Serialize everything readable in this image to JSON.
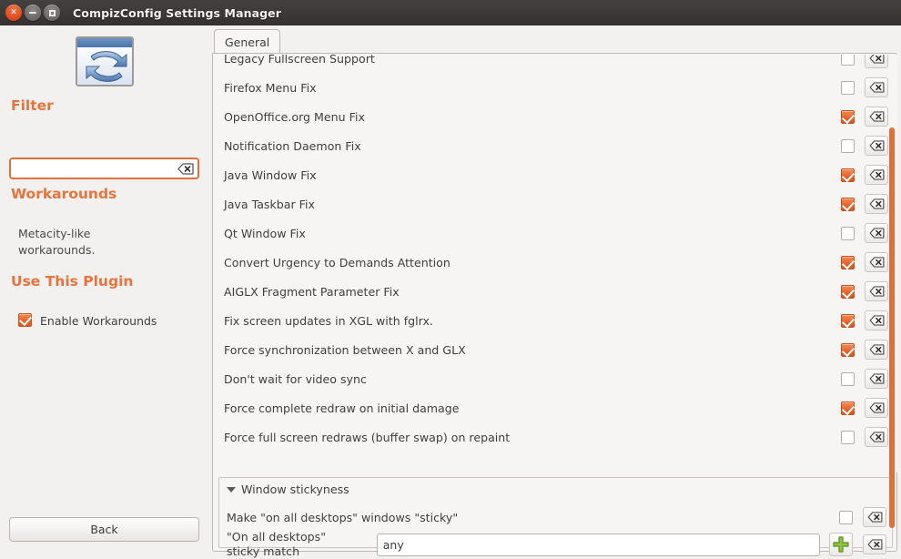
{
  "window": {
    "title": "CompizConfig Settings Manager",
    "controls": [
      {
        "name": "close",
        "glyph": "✕"
      },
      {
        "name": "minimize",
        "glyph": "−"
      },
      {
        "name": "maximize",
        "glyph": "□"
      }
    ]
  },
  "sidebar": {
    "plugin_icon": "workarounds-plugin-icon",
    "filter_heading": "Filter",
    "filter_value": "",
    "filter_placeholder": "",
    "plugin_heading": "Workarounds",
    "plugin_description": "Metacity-like workarounds.",
    "use_plugin_heading": "Use This Plugin",
    "enable_label": "Enable Workarounds",
    "enable_checked": true,
    "back_label": "Back"
  },
  "notebook": {
    "tabs": [
      {
        "label": "General",
        "active": true
      }
    ]
  },
  "options": [
    {
      "label": "Legacy Fullscreen Support",
      "checked": false,
      "reset": "reset-icon",
      "clipped": true
    },
    {
      "label": "Firefox Menu Fix",
      "checked": false,
      "reset": "reset-icon"
    },
    {
      "label": "OpenOffice.org Menu Fix",
      "checked": true,
      "reset": "reset-icon"
    },
    {
      "label": "Notification Daemon Fix",
      "checked": false,
      "reset": "reset-icon"
    },
    {
      "label": "Java Window Fix",
      "checked": true,
      "reset": "reset-icon"
    },
    {
      "label": "Java Taskbar Fix",
      "checked": true,
      "reset": "reset-icon"
    },
    {
      "label": "Qt Window Fix",
      "checked": false,
      "reset": "reset-icon"
    },
    {
      "label": "Convert Urgency to Demands Attention",
      "checked": true,
      "reset": "reset-icon"
    },
    {
      "label": "AIGLX Fragment Parameter Fix",
      "checked": true,
      "reset": "reset-icon"
    },
    {
      "label": "Fix screen updates in XGL with fglrx.",
      "checked": true,
      "reset": "reset-icon"
    },
    {
      "label": "Force synchronization between X and GLX",
      "checked": true,
      "reset": "reset-icon"
    },
    {
      "label": "Don't wait for video sync",
      "checked": false,
      "reset": "reset-icon"
    },
    {
      "label": "Force complete redraw on initial damage",
      "checked": true,
      "reset": "reset-icon"
    },
    {
      "label": "Force full screen redraws (buffer swap) on repaint",
      "checked": false,
      "reset": "reset-icon"
    }
  ],
  "group": {
    "title": "Window stickyness",
    "expanded": true,
    "sticky_label": "Make \"on all desktops\" windows \"sticky\"",
    "sticky_checked": false,
    "match_label_line1": "\"On all desktops\"",
    "match_label_line2": "sticky match",
    "match_value": "any",
    "match_placeholder": "",
    "add_icon": "plus-icon",
    "reset_icon": "reset-icon"
  },
  "scrollbar": {
    "orientation": "vertical",
    "accent_color": "#e3703c"
  },
  "colors": {
    "accent": "#e8743b",
    "checkbox_on": "#e4662c",
    "titlebar": "#3c3937",
    "panel_bg": "#f6f5f4",
    "window_bg": "#f2f1f0"
  }
}
